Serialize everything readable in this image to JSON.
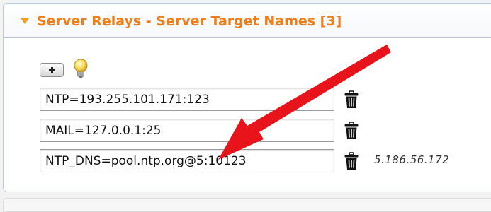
{
  "panel": {
    "title": "Server Relays - Server Target Names [3]",
    "accent_color": "#ef7d1a",
    "collapse_icon": "triangle-down-icon"
  },
  "toolbar": {
    "add_icon": "plus-icon",
    "hint_icon": "lightbulb-icon"
  },
  "relays": [
    {
      "value": "NTP=193.255.101.171:123",
      "delete_icon": "trash-icon",
      "resolved": ""
    },
    {
      "value": "MAIL=127.0.0.1:25",
      "delete_icon": "trash-icon",
      "resolved": ""
    },
    {
      "value": "NTP_DNS=pool.ntp.org@5:10123",
      "delete_icon": "trash-icon",
      "resolved": "5.186.56.172"
    }
  ],
  "annotation": {
    "type": "red-arrow",
    "color": "#e8141b",
    "points_to": "relays.2"
  }
}
